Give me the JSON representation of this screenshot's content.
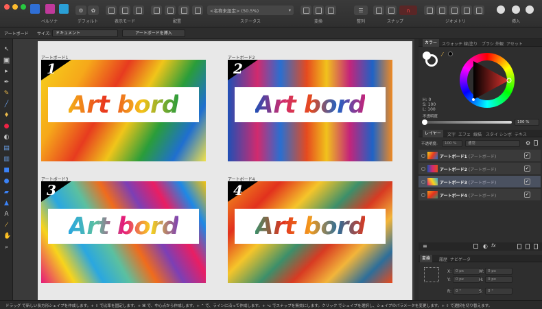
{
  "toolbar": {
    "persona_label": "ペルソナ",
    "default_label": "デフォルト",
    "view_mode_label": "表示モード",
    "arrange_label": "配置",
    "status_label": "ステータス",
    "status_value": "<名称未設定> (50.5%)",
    "transform_label": "変換",
    "align_label": "整列",
    "snap_label": "スナップ",
    "geometry_label": "ジオメトリ",
    "insert_label": "挿入"
  },
  "context": {
    "tool_label": "アートボード",
    "size_label": "サイズ:",
    "size_value": "ドキュメント",
    "insert_button": "アートボードを挿入"
  },
  "artboards": [
    {
      "label": "アートボード1",
      "number": "1",
      "text": "Art bord"
    },
    {
      "label": "アートボード2",
      "number": "2",
      "text": "Art bord"
    },
    {
      "label": "アートボード3",
      "number": "3",
      "text": "Art bord"
    },
    {
      "label": "アートボード4",
      "number": "4",
      "text": "Art bord"
    }
  ],
  "color_panel": {
    "tabs": [
      "カラー",
      "スウォッチ",
      "線/塗り",
      "ブラシ",
      "外観",
      "アセット"
    ],
    "h": "H: 0",
    "s": "S: 100",
    "l": "L: 100",
    "opacity_label": "不透明度",
    "opacity_value": "100 %",
    "accent": "#e3342f"
  },
  "layers_panel": {
    "tabs": [
      "レイヤー",
      "文字",
      "エフェ",
      "線描",
      "スタイ",
      "シンボ",
      "テキス"
    ],
    "opacity_label": "不透明度:",
    "opacity_value": "100 %",
    "blend_value": "通常",
    "layers": [
      {
        "name": "アートボード1",
        "kind": "(アートボード)",
        "selected": false
      },
      {
        "name": "アートボード2",
        "kind": "(アートボード)",
        "selected": false
      },
      {
        "name": "アートボード3",
        "kind": "(アートボード)",
        "selected": true
      },
      {
        "name": "アートボード4",
        "kind": "(アートボード)",
        "selected": false
      }
    ]
  },
  "transform_panel": {
    "tabs": [
      "変換",
      "履歴",
      "ナビゲータ"
    ],
    "x_label": "X:",
    "x_value": "0 px",
    "y_label": "Y:",
    "y_value": "0 px",
    "w_label": "W:",
    "w_value": "0 px",
    "h_label": "H:",
    "h_value": "0 px",
    "r_label": "R:",
    "r_value": "0 °",
    "s_label": "S:",
    "s_value": "0 °"
  },
  "status_bar": {
    "text": "ドラッグ で新しい長方形シェイプを作成します。+ ⇧ で比率を固定します。+ ⌘ で、中心点から作成します。+ ⌃ で、ラインに沿って作成します。+ ⌥ でスナップを無効にします。クリック でシェイプを選択し、シェイプのパラメータを変更します。+ ⇧ で選択を切り替えます。"
  }
}
